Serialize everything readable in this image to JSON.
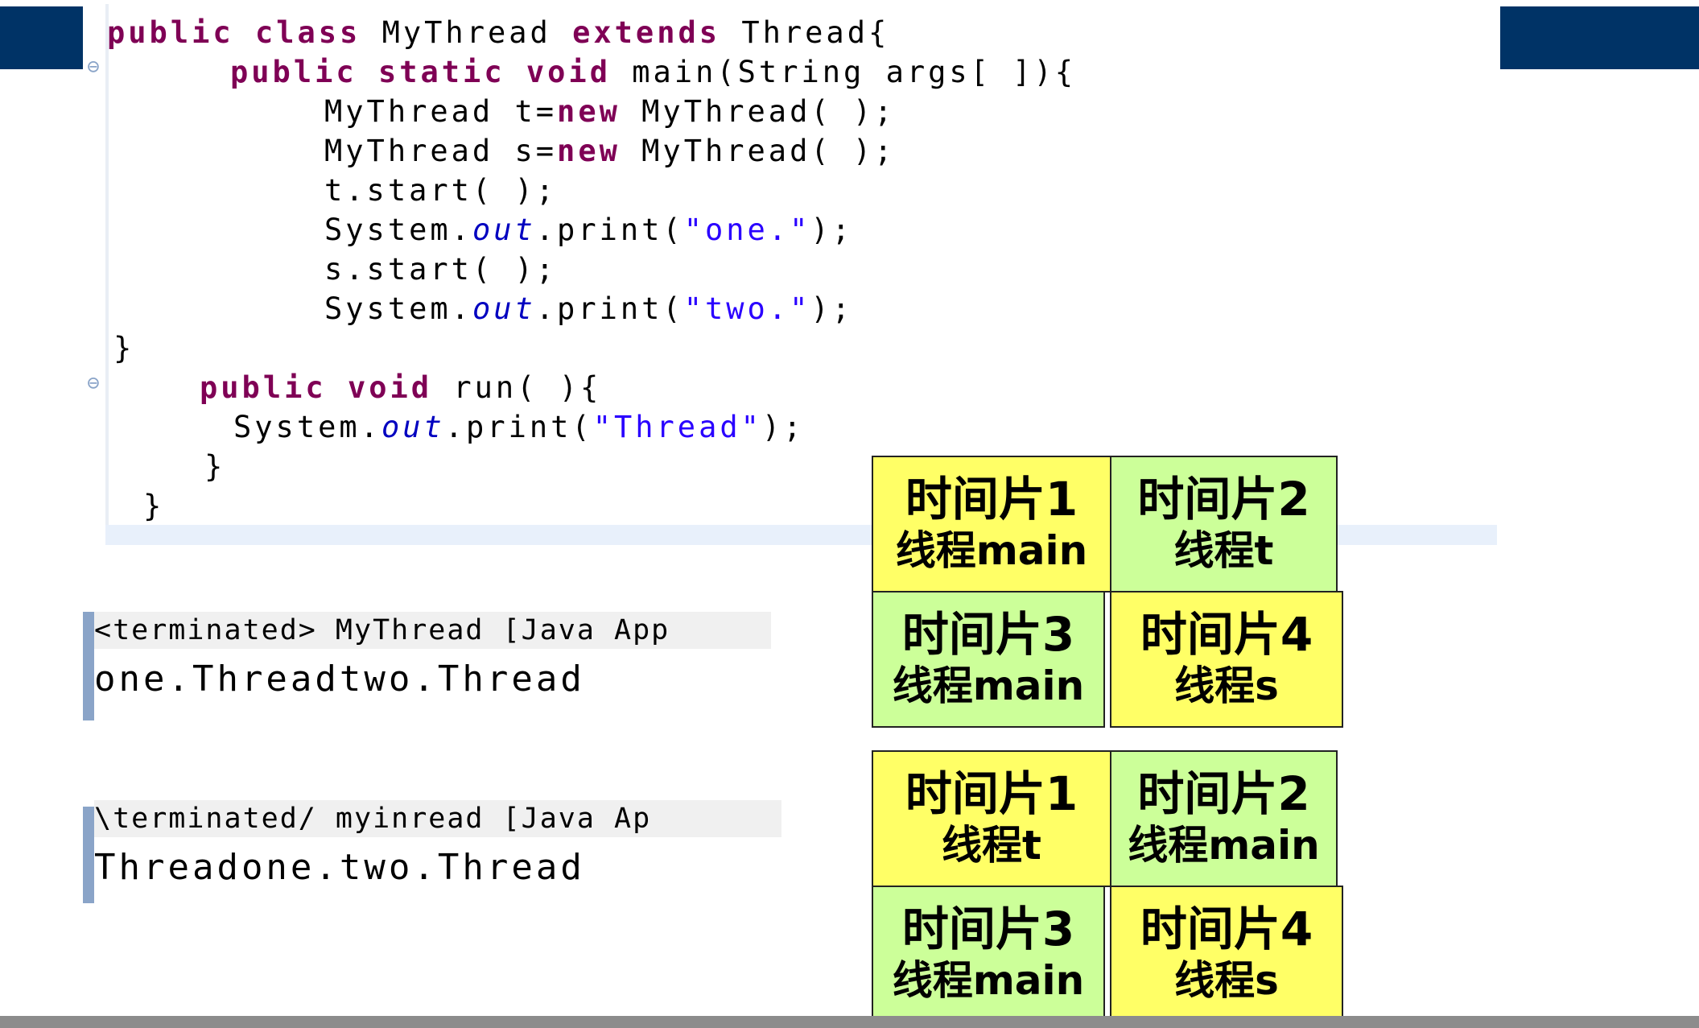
{
  "code": {
    "line1": {
      "kw1": "public",
      "kw2": "class",
      "name": "MyThread",
      "kw3": "extends",
      "rest": "Thread{"
    },
    "line2": {
      "kw1": "public",
      "kw2": "static",
      "kw3": "void",
      "rest": "main(String args[ ]){"
    },
    "line3": {
      "pre": "MyThread t=",
      "kw": "new",
      "post": " MyThread( );"
    },
    "line4": {
      "pre": "MyThread s=",
      "kw": "new",
      "post": " MyThread( );"
    },
    "line5": "t.start( );",
    "line6": {
      "pre": "System.",
      "field": "out",
      "mid": ".print(",
      "str": "\"one.\"",
      "post": ");"
    },
    "line7": "s.start( );",
    "line8": {
      "pre": "System.",
      "field": "out",
      "mid": ".print(",
      "str": "\"two.\"",
      "post": ");"
    },
    "line9": "}",
    "line10": {
      "kw1": "public",
      "kw2": "void",
      "rest": "run( ){"
    },
    "line11": {
      "pre": "System.",
      "field": "out",
      "mid": ".print(",
      "str": "\"Thread\"",
      "post": ");"
    },
    "line12": "}",
    "line13": "}"
  },
  "consoles": [
    {
      "header": "<terminated> MyThread [Java App",
      "output": "one.Threadtwo.Thread"
    },
    {
      "header": "\\terminated/ myinread [Java Ap",
      "output": "Threadone.two.Thread"
    }
  ],
  "timeslices": {
    "top": [
      {
        "slice": "时间片1",
        "thread": "线程main",
        "color": "yellow"
      },
      {
        "slice": "时间片2",
        "thread": "线程t",
        "color": "green"
      },
      {
        "slice": "时间片3",
        "thread": "线程main",
        "color": "green"
      },
      {
        "slice": "时间片4",
        "thread": "线程s",
        "color": "yellow"
      }
    ],
    "bottom": [
      {
        "slice": "时间片1",
        "thread": "线程t",
        "color": "yellow"
      },
      {
        "slice": "时间片2",
        "thread": "线程main",
        "color": "green"
      },
      {
        "slice": "时间片3",
        "thread": "线程main",
        "color": "green"
      },
      {
        "slice": "时间片4",
        "thread": "线程s",
        "color": "yellow"
      }
    ]
  },
  "colors": {
    "header_bar": "#003366",
    "keyword": "#7f0055",
    "string": "#2a00ff",
    "field": "#0000c0",
    "yellow": "#ffff66",
    "green": "#ccff99"
  }
}
